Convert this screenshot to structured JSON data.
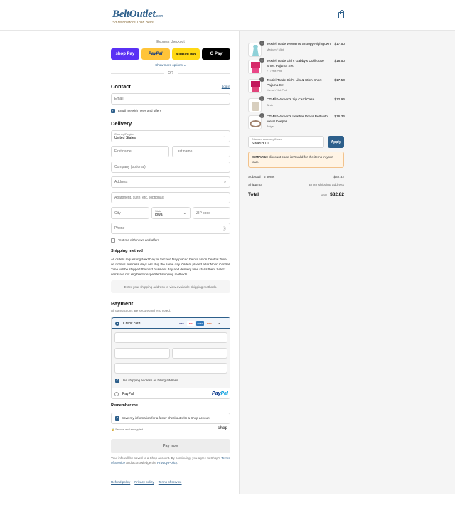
{
  "brand": {
    "name": "BeltOutlet",
    "suffix": ".com",
    "tagline": "So Much More Than Belts"
  },
  "express": {
    "title": "Express checkout",
    "buttons": [
      "shop Pay",
      "PayPal",
      "amazon pay",
      "G Pay"
    ],
    "show_more": "Show more options ⌄",
    "or": "OR"
  },
  "contact": {
    "heading": "Contact",
    "login": "Log in",
    "email_placeholder": "Email",
    "news_label": "Email me with news and offers"
  },
  "delivery": {
    "heading": "Delivery",
    "country_label": "Country/Region",
    "country_value": "United States",
    "first_name": "First name",
    "last_name": "Last name",
    "company": "Company (optional)",
    "address": "Address",
    "apartment": "Apartment, suite, etc. (optional)",
    "city": "City",
    "state_label": "State",
    "state_value": "Iowa",
    "zip": "ZIP code",
    "phone": "Phone",
    "text_label": "Text me with news and offers"
  },
  "shipping": {
    "heading": "Shipping method",
    "description": "All orders requesting Next Day or Second Day placed before Noon Central Time on normal business days will ship the same day. Orders placed after Noon Central Time will be shipped the next business day and delivery time starts then. Select items are not eligible for expedited shipping methods.",
    "box_text": "Enter your shipping address to view available shipping methods."
  },
  "payment": {
    "heading": "Payment",
    "subtitle": "All transactions are secure and encrypted.",
    "credit_card": "Credit card",
    "cards": [
      "VISA",
      "MC",
      "AMEX",
      "DISC",
      "+6"
    ],
    "billing_label": "Use shipping address as billing address",
    "paypal_label": "PayPal",
    "paypal_logo_a": "Pay",
    "paypal_logo_b": "Pal"
  },
  "remember": {
    "heading": "Remember me",
    "save_label": "Save my information for a faster checkout with a Shop account",
    "secure": "Secure and encrypted",
    "shop_logo": "shop"
  },
  "pay_now": "Pay now",
  "legal": {
    "text": "Your info will be saved to a Shop account. By continuing, you agree to Shop's",
    "tos": "Terms of Service",
    "mid": "and acknowledge the",
    "privacy": "Privacy Policy",
    "end": "."
  },
  "footer_links": [
    "Refund policy",
    "Privacy policy",
    "Terms of service"
  ],
  "cart": {
    "items": [
      {
        "name": "Textiel Trade Women's Snoopy Nightgown",
        "variant": "Medium / Mint",
        "price": "$17.50",
        "qty": "1"
      },
      {
        "name": "Textiel Trade Girl's Gabby's Dollhouse Short Pajama Set",
        "variant": "7T / Hot Pink",
        "price": "$18.50",
        "qty": "1"
      },
      {
        "name": "Textiel Trade Girl's Lilo & Stich Short Pajama Set",
        "variant": "Xsmall / Hot Pink",
        "price": "$17.50",
        "qty": "1"
      },
      {
        "name": "CTM® Women's Zip Card Case",
        "variant": "Birch",
        "price": "$12.96",
        "qty": "1"
      },
      {
        "name": "CTM® Women's Leather Dress Belt with Metal Keeper",
        "variant": "Beige",
        "price": "$16.36",
        "qty": "1"
      }
    ],
    "discount_label": "Discount code or gift card",
    "discount_value": "SIMPLY10",
    "apply": "Apply",
    "notice_code": "SIMPLY10",
    "notice_text": " discount code isn't valid for the items in your cart.",
    "subtotal_label": "Subtotal · 5 items",
    "subtotal_value": "$82.82",
    "shipping_label": "Shipping",
    "shipping_value": "Enter shipping address",
    "total_label": "Total",
    "currency": "USD",
    "total_value": "$82.82"
  }
}
